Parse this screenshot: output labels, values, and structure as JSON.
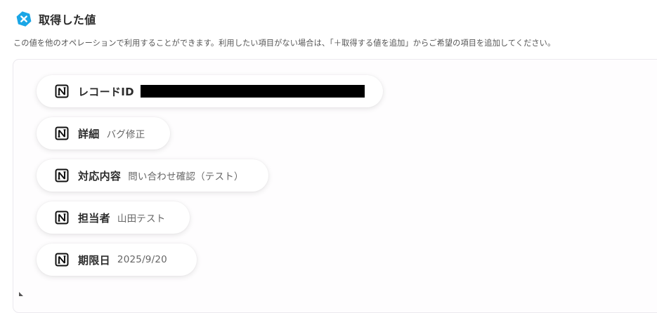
{
  "header": {
    "title": "取得した値",
    "brand_color": "#1aa6e6"
  },
  "description": "この値を他のオペレーションで利用することができます。利用したい項目がない場合は、「＋取得する値を追加」からご希望の項目を追加してください。",
  "icons": {
    "header": "yoom-logo-icon",
    "item": "notion-icon"
  },
  "items": [
    {
      "label": "レコードID",
      "value": "",
      "redacted": true
    },
    {
      "label": "詳細",
      "value": "バグ修正"
    },
    {
      "label": "対応内容",
      "value": "問い合わせ確認（テスト）"
    },
    {
      "label": "担当者",
      "value": "山田テスト"
    },
    {
      "label": "期限日",
      "value": "2025/9/20"
    }
  ]
}
